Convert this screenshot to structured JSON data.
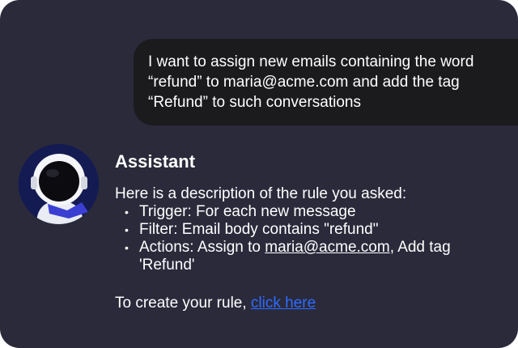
{
  "user_message": {
    "lines": [
      "I want to assign new emails containing the word",
      "“refund” to maria@acme.com and add the tag",
      "“Refund” to such conversations"
    ]
  },
  "assistant": {
    "name": "Assistant",
    "avatar_icon": "astronaut-avatar-icon",
    "intro": "Here is a description of the rule you asked:",
    "bullets": {
      "trigger": "Trigger: For each new message",
      "filter": "Filter: Email body contains \"refund\"",
      "actions_prefix": "Actions: Assign to ",
      "actions_email": "maria@acme.com",
      "actions_suffix": ", Add tag 'Refund'"
    },
    "bullet_glyph": "•",
    "cta_prefix": "To create your rule, ",
    "cta_link": "click here"
  },
  "colors": {
    "background": "#2a2a3b",
    "user_bubble": "#1b1b1e",
    "link": "#2f6bff",
    "avatar_bg": "#141a52"
  }
}
